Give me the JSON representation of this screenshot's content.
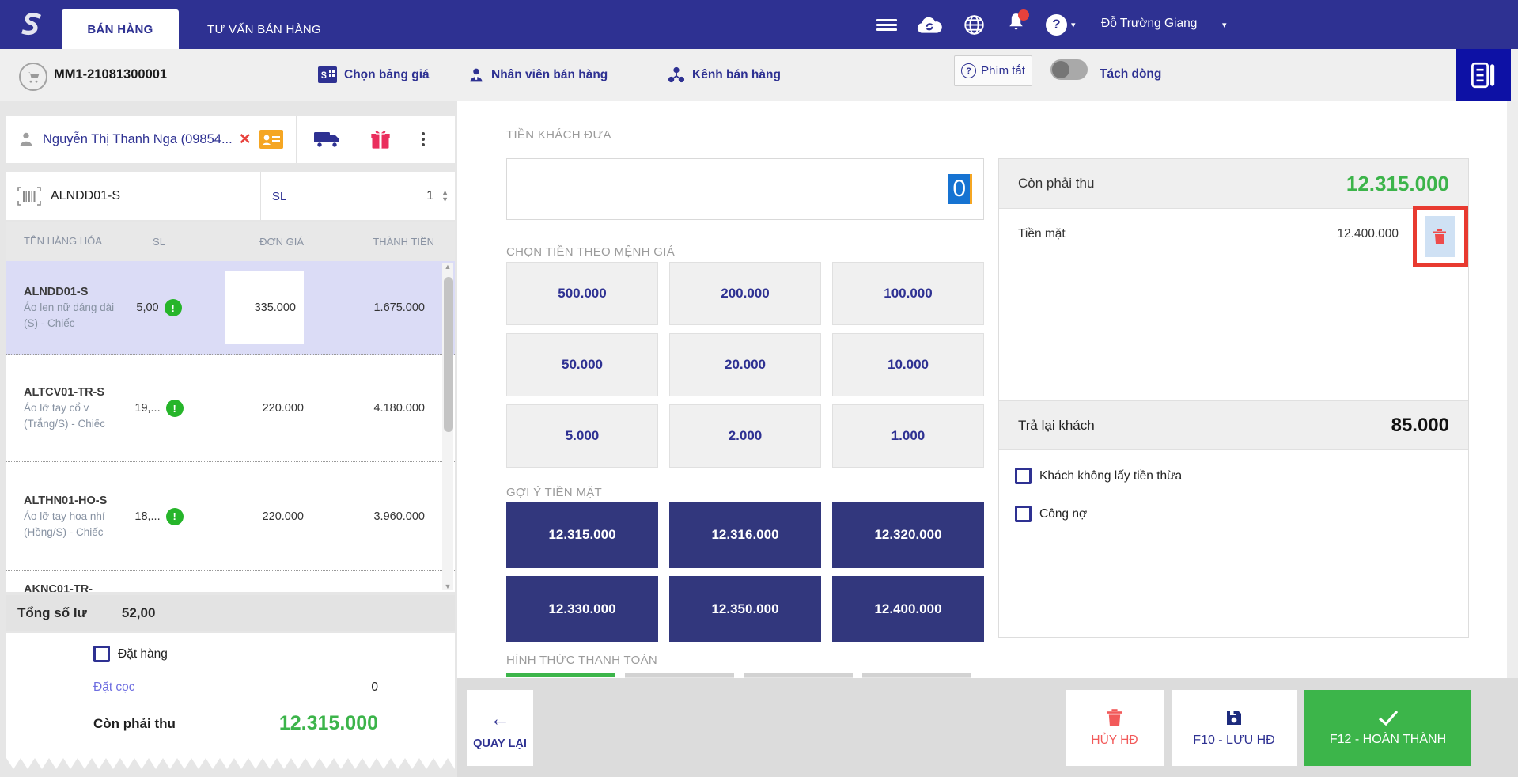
{
  "navbar": {
    "tabs": [
      {
        "label": "BÁN HÀNG"
      },
      {
        "label": "TƯ VẤN BÁN HÀNG"
      }
    ],
    "user_name": "Đỗ Trường Giang"
  },
  "toolbar": {
    "order_code": "MM1-21081300001",
    "price_book_label": "Chọn bảng giá",
    "staff_label": "Nhân viên bán hàng",
    "channel_label": "Kênh bán hàng",
    "shortcut_label": "Phím tắt",
    "split_line_label": "Tách dòng"
  },
  "cart": {
    "customer": "Nguyễn Thị Thanh Nga (09854...",
    "search_code": "ALNDD01-S",
    "qty_label": "SL",
    "qty_value": "1",
    "table": {
      "headers": [
        "TÊN HÀNG HÓA",
        "SL",
        "ĐƠN GIÁ",
        "THÀNH TIỀN"
      ],
      "rows": [
        {
          "code": "ALNDD01-S",
          "name": "Áo len nữ dáng dài (S) - Chiếc",
          "qty": "5,00",
          "price": "335.000",
          "total": "1.675.000"
        },
        {
          "code": "ALTCV01-TR-S",
          "name": "Áo lỡ tay cổ v (Trắng/S) - Chiếc",
          "qty": "19,...",
          "price": "220.000",
          "total": "4.180.000"
        },
        {
          "code": "ALTHN01-HO-S",
          "name": "Áo lỡ tay hoa nhí (Hồng/S) - Chiếc",
          "qty": "18,...",
          "price": "220.000",
          "total": "3.960.000"
        },
        {
          "code": "AKNC01-TR-",
          "name": "",
          "qty": "",
          "price": "",
          "total": ""
        }
      ]
    },
    "total_qty_label": "Tổng số lư",
    "total_qty_value": "52,00",
    "order_checkbox_label": "Đặt hàng",
    "deposit_label": "Đặt cọc",
    "deposit_value": "0",
    "remaining_label": "Còn phải thu",
    "remaining_value": "12.315.000"
  },
  "payment": {
    "customer_cash_label": "TIỀN KHÁCH ĐƯA",
    "customer_cash_value": "0",
    "denomination_label": "CHỌN TIỀN THEO MỆNH GIÁ",
    "denominations": [
      "500.000",
      "200.000",
      "100.000",
      "50.000",
      "20.000",
      "10.000",
      "5.000",
      "2.000",
      "1.000"
    ],
    "suggestion_label": "GỢI Ý TIỀN MẶT",
    "suggestions": [
      "12.315.000",
      "12.316.000",
      "12.320.000",
      "12.330.000",
      "12.350.000",
      "12.400.000"
    ],
    "method_label": "HÌNH THỨC THANH TOÁN"
  },
  "summary": {
    "remaining_label": "Còn phải thu",
    "remaining_value": "12.315.000",
    "cash_label": "Tiền mặt",
    "cash_value": "12.400.000",
    "change_label": "Trả lại khách",
    "change_value": "85.000",
    "no_change_checkbox": "Khách không lấy tiền thừa",
    "debt_checkbox": "Công nợ"
  },
  "footer": {
    "back_label": "QUAY LẠI",
    "cancel_label": "HỦY HĐ",
    "save_label": "F10 - LƯU HĐ",
    "complete_label": "F12 - HOÀN THÀNH"
  },
  "glyphs": {
    "back_arrow": "←",
    "caret_down": "▾",
    "close": "✕",
    "question": "?",
    "exclamation": "!",
    "arrow_up": "▲",
    "arrow_down": "▼"
  },
  "colors": {
    "navy": "#2e3192",
    "suggestion_navy": "#32377d",
    "green": "#3cb44a",
    "red": "#e83a30",
    "selected_row": "#dbdcf6",
    "selection_blue": "#1673d2",
    "delete_bg": "#cfe1f4"
  }
}
